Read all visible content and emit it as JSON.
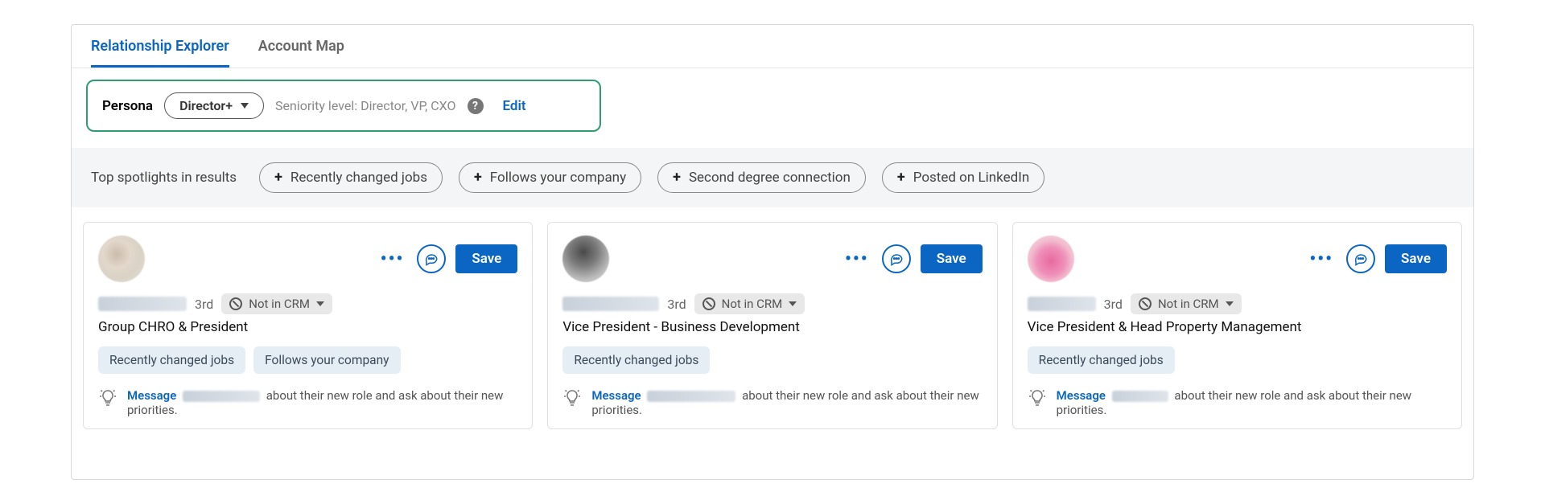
{
  "tabs": {
    "relationship": "Relationship Explorer",
    "accountMap": "Account Map"
  },
  "persona": {
    "label": "Persona",
    "selected": "Director+",
    "seniorityLabel": "Seniority level:",
    "seniorityValue": "Director, VP, CXO",
    "editLabel": "Edit"
  },
  "spotlights": {
    "label": "Top spotlights in results",
    "chips": [
      "Recently changed jobs",
      "Follows your company",
      "Second degree connection",
      "Posted on LinkedIn"
    ]
  },
  "common": {
    "save": "Save",
    "notInCrm": "Not in CRM",
    "messageWord": "Message",
    "hintSuffix": "about their new role and ask about their new priorities."
  },
  "cards": [
    {
      "degree": "3rd",
      "title": "Group CHRO & President",
      "tags": [
        "Recently changed jobs",
        "Follows your company"
      ]
    },
    {
      "degree": "3rd",
      "title": "Vice President - Business Development",
      "tags": [
        "Recently changed jobs"
      ]
    },
    {
      "degree": "3rd",
      "title": "Vice President & Head Property Management",
      "tags": [
        "Recently changed jobs"
      ]
    }
  ]
}
